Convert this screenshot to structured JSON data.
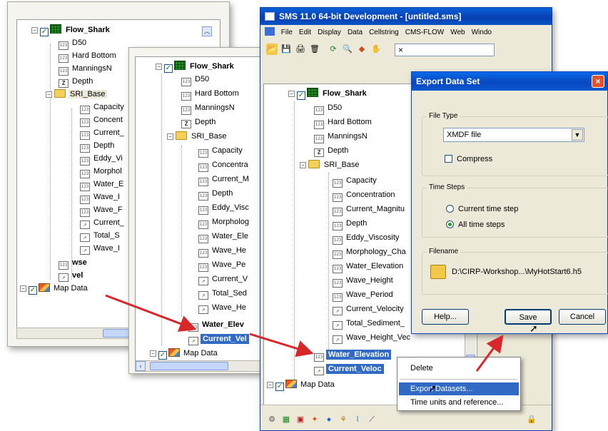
{
  "trees": {
    "panel1": {
      "root": "Flow_Shark",
      "items": [
        "D50",
        "Hard Bottom",
        "ManningsN",
        "Depth"
      ],
      "folder": "SRI_Base",
      "folder_items": [
        "Capacity",
        "Concent",
        "Current_",
        "Depth",
        "Eddy_Vi",
        "Morphol",
        "Water_E",
        "Wave_I",
        "Wave_F",
        "Current_",
        "Total_S",
        "Wave_I"
      ],
      "extra": [
        "wse",
        "vel"
      ],
      "map": "Map Data"
    },
    "panel2": {
      "root": "Flow_Shark",
      "items": [
        "D50",
        "Hard Bottom",
        "ManningsN",
        "Depth"
      ],
      "folder": "SRI_Base",
      "folder_items": [
        "Capacity",
        "Concentra",
        "Current_M",
        "Depth",
        "Eddy_Visc",
        "Morpholog",
        "Water_Ele",
        "Wave_He",
        "Wave_Pe",
        "Current_V",
        "Total_Sed",
        "Wave_He"
      ],
      "extra": [
        "Water_Elev",
        "Current_Vel"
      ],
      "map": "Map Data"
    },
    "panel3": {
      "root": "Flow_Shark",
      "items": [
        "D50",
        "Hard Bottom",
        "ManningsN",
        "Depth"
      ],
      "folder": "SRI_Base",
      "folder_items": [
        "Capacity",
        "Concentration",
        "Current_Magnitu",
        "Depth",
        "Eddy_Viscosity",
        "Morphology_Cha",
        "Water_Elevation",
        "Wave_Height",
        "Wave_Period",
        "Current_Velocity",
        "Total_Sediment_",
        "Wave_Height_Vec"
      ],
      "extra": [
        "Water_Elevation",
        "Current_Veloc"
      ],
      "map": "Map Data"
    }
  },
  "app": {
    "title": "SMS 11.0 64-bit Development - [untitled.sms]",
    "menus": [
      "File",
      "Edit",
      "Display",
      "Data",
      "Cellstring",
      "CMS-FLOW",
      "Web",
      "Windo"
    ],
    "toolbar_field": "×"
  },
  "dialog": {
    "title": "Export Data Set",
    "file_type_label": "File Type",
    "file_type_value": "XMDF file",
    "compress_label": "Compress",
    "time_steps_label": "Time Steps",
    "current_step_label": "Current time step",
    "all_steps_label": "All time steps",
    "filename_label": "Filename",
    "filename_value": "D:\\CIRP-Workshop...\\MyHotStart6.h5",
    "help_label": "Help...",
    "save_label": "Save",
    "cancel_label": "Cancel"
  },
  "context_menu": {
    "items": [
      "Delete",
      "Export Datasets...",
      "Time units and reference..."
    ],
    "highlighted": 1
  },
  "icons": {
    "scalar": "123",
    "vector": "arrow-vector-icon",
    "elevation": "Z"
  },
  "colors": {
    "selection": "#316ac5",
    "xp_title": "#0a54c8",
    "arrow": "#d8262a"
  }
}
